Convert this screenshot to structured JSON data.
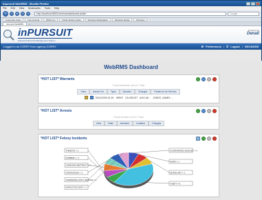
{
  "browser": {
    "title": "Inpursuit WebRMS - Mozilla Firefox",
    "menu": [
      "File",
      "Edit",
      "View",
      "Bookmarks",
      "Tools",
      "Help"
    ],
    "address": "http://localhost:8522/webrms/dashboard.action",
    "search_placeholder": "Google",
    "bookmarks": [
      "Customize Links",
      "Free Hotmail",
      "RMS.com",
      "Public Station Guide",
      "Windows Marketplace",
      "Windows Media",
      "Windows"
    ],
    "tab_label": "Inpursuit WebRMS"
  },
  "app": {
    "logo": "inPURSUIT",
    "logo_tagline": "Advanced Records Management System",
    "powered_by": "Powered by",
    "brand": "Denali",
    "user_message": "Logged in as CORRY from agency CORRY",
    "preferences": "Preferences",
    "logout": "Logout",
    "date": "09/14/2009"
  },
  "dashboard": {
    "title": "WebRMS Dashboard",
    "warrants": {
      "title": "*HOT LIST* Warrants",
      "sub": "Found Warrants List of 1 Total",
      "columns": [
        "View",
        "Issued On",
        "Type",
        "Number",
        "Charges",
        "Parties to be Service"
      ],
      "row": {
        "issued": "09/11/2009 01:51",
        "type": "WRNT",
        "number": "CD-000197",
        "charges": "AGG AS...",
        "parties": "JONES, JAMES ..."
      }
    },
    "arrests": {
      "title": "*HOT LIST* Arrests",
      "sub": "Found Arrests List of 1 Total",
      "columns": [
        "View",
        "Date",
        "Arrestee",
        "Location",
        "Charges"
      ]
    },
    "felony": {
      "title": "*HOT LIST* Felony Incidents"
    }
  },
  "chart_data": {
    "type": "pie",
    "categories": [
      "AGGRAVATED ASSAULT = 1",
      "RAPE = 1",
      "BURGLARY = 1",
      "THEFT = 6",
      "THREATS = 1",
      "ROBBERY = 1",
      "HOMICIDE ABSTRACT = 1",
      "CARJACKING = 1",
      "TAMPERING WITH VEHICLE = 1",
      "NARCOTICS DIST = 1"
    ],
    "values": [
      1,
      1,
      1,
      6,
      1,
      1,
      1,
      1,
      1,
      1
    ],
    "colors": [
      "#3d4fb8",
      "#d43030",
      "#e0c030",
      "#43c0e0",
      "#3aa84a",
      "#b84cc0",
      "#e87a30",
      "#7ad0c0",
      "#2d5fb8",
      "#e0a0d0"
    ]
  }
}
